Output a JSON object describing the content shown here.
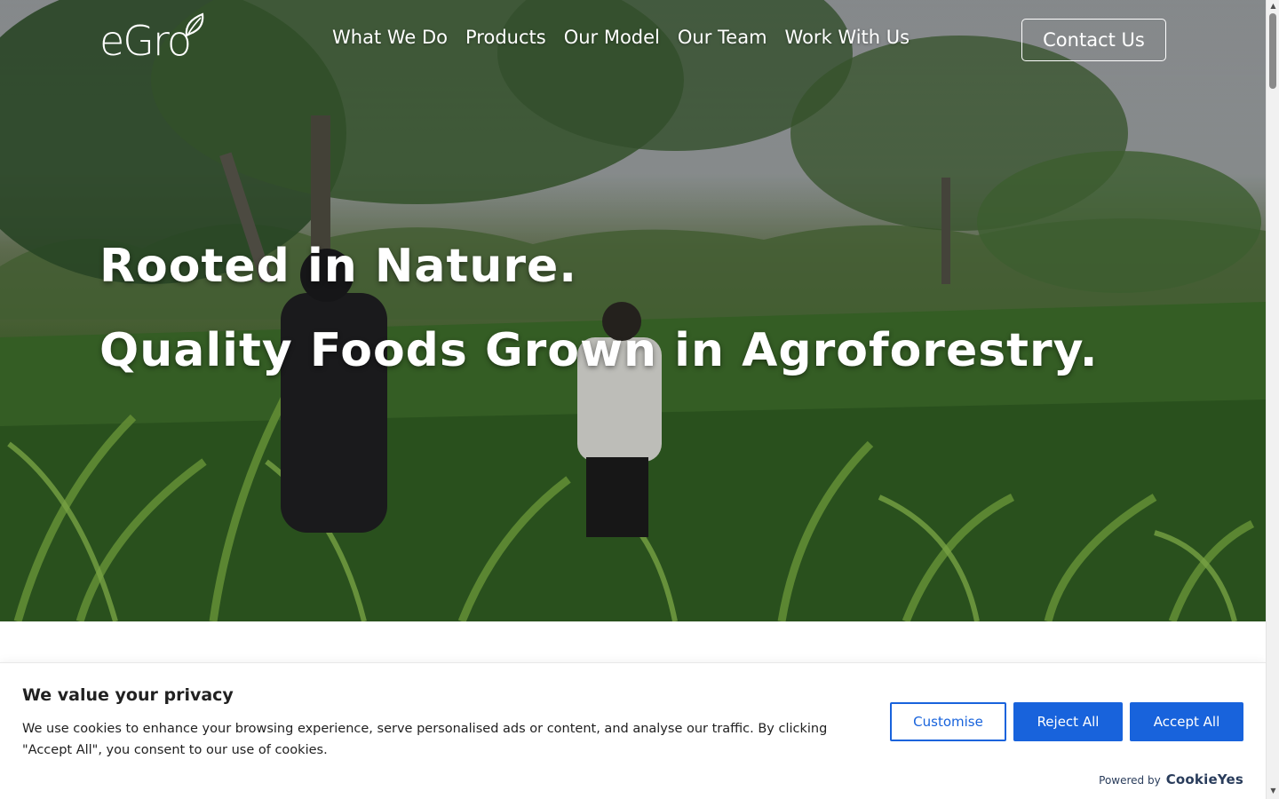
{
  "brand": {
    "logo_text": "eGro"
  },
  "nav": {
    "items": [
      {
        "label": "What We Do"
      },
      {
        "label": "Products"
      },
      {
        "label": "Our Model"
      },
      {
        "label": "Our Team"
      },
      {
        "label": "Work With Us"
      }
    ],
    "contact_label": "Contact Us"
  },
  "hero": {
    "line1": "Rooted in Nature.",
    "line2": "Quality Foods Grown in Agroforestry."
  },
  "cookie": {
    "title": "We value your privacy",
    "text": "We use cookies to enhance your browsing experience, serve personalised ads or content, and analyse our traffic. By clicking \"Accept All\", you consent to our use of cookies.",
    "customise_label": "Customise",
    "reject_label": "Reject All",
    "accept_label": "Accept All",
    "powered_label": "Powered by",
    "powered_brand": "CookieYes",
    "accent_color": "#1863dc"
  },
  "icons": {
    "leaf": "leaf-icon",
    "scroll_up": "scroll-up-arrow-icon",
    "scroll_down": "scroll-down-arrow-icon"
  }
}
